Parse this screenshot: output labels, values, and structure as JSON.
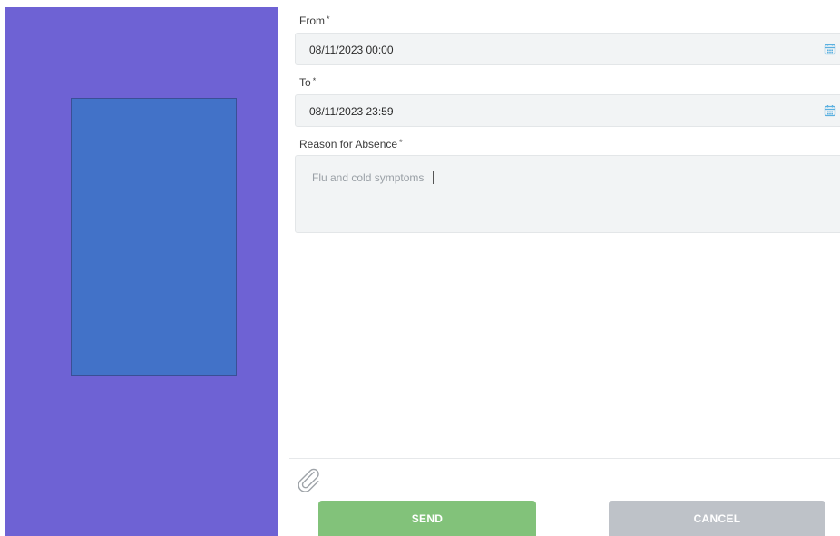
{
  "form": {
    "from": {
      "label": "From",
      "required_mark": "*",
      "value": "08/11/2023 00:00"
    },
    "to": {
      "label": "To",
      "required_mark": "*",
      "value": "08/11/2023 23:59"
    },
    "reason": {
      "label": "Reason for Absence",
      "required_mark": "*",
      "value": "Flu and cold symptoms"
    }
  },
  "actions": {
    "send_label": "SEND",
    "cancel_label": "CANCEL"
  },
  "icons": {
    "calendar": "calendar-icon",
    "attachment": "paperclip-icon"
  },
  "colors": {
    "left_panel": "#6e62d4",
    "left_card": "#4272c8",
    "send_button": "#82c27a",
    "cancel_button": "#bec2c8",
    "calendar_icon": "#5bb0e0"
  }
}
